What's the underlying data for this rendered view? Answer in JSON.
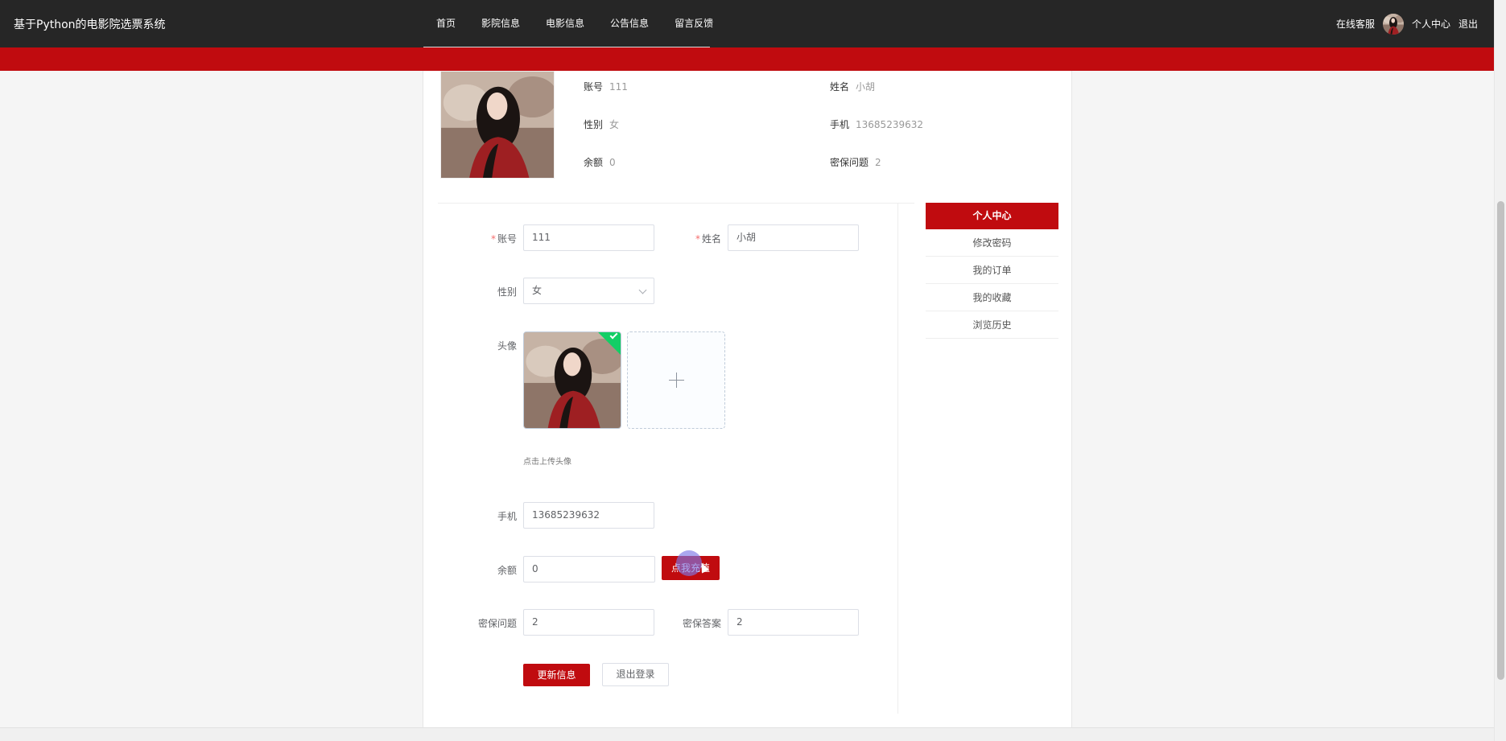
{
  "header": {
    "site_title": "基于Python的电影院选票系统",
    "nav": [
      "首页",
      "影院信息",
      "电影信息",
      "公告信息",
      "留言反馈"
    ],
    "service": "在线客服",
    "user_center": "个人中心",
    "logout": "退出"
  },
  "profile": {
    "account_label": "账号",
    "account": "111",
    "name_label": "姓名",
    "name": "小胡",
    "gender_label": "性别",
    "gender": "女",
    "phone_label": "手机",
    "phone": "13685239632",
    "balance_label": "余额",
    "balance": "0",
    "question_label": "密保问题",
    "question": "2"
  },
  "form": {
    "account_label": "账号",
    "account": "111",
    "name_label": "姓名",
    "name": "小胡",
    "gender_label": "性别",
    "gender": "女",
    "avatar_label": "头像",
    "upload_tip": "点击上传头像",
    "phone_label": "手机",
    "phone": "13685239632",
    "balance_label": "余额",
    "balance": "0",
    "recharge_label": "点我充值",
    "question_label": "密保问题",
    "question": "2",
    "answer_label": "密保答案",
    "answer": "2",
    "update_label": "更新信息",
    "logout_label": "退出登录"
  },
  "sidebar": {
    "title": "个人中心",
    "items": [
      "修改密码",
      "我的订单",
      "我的收藏",
      "浏览历史"
    ]
  },
  "colors": {
    "accent": "#c00b0f",
    "topbar": "#262626",
    "success": "#13ce66"
  }
}
